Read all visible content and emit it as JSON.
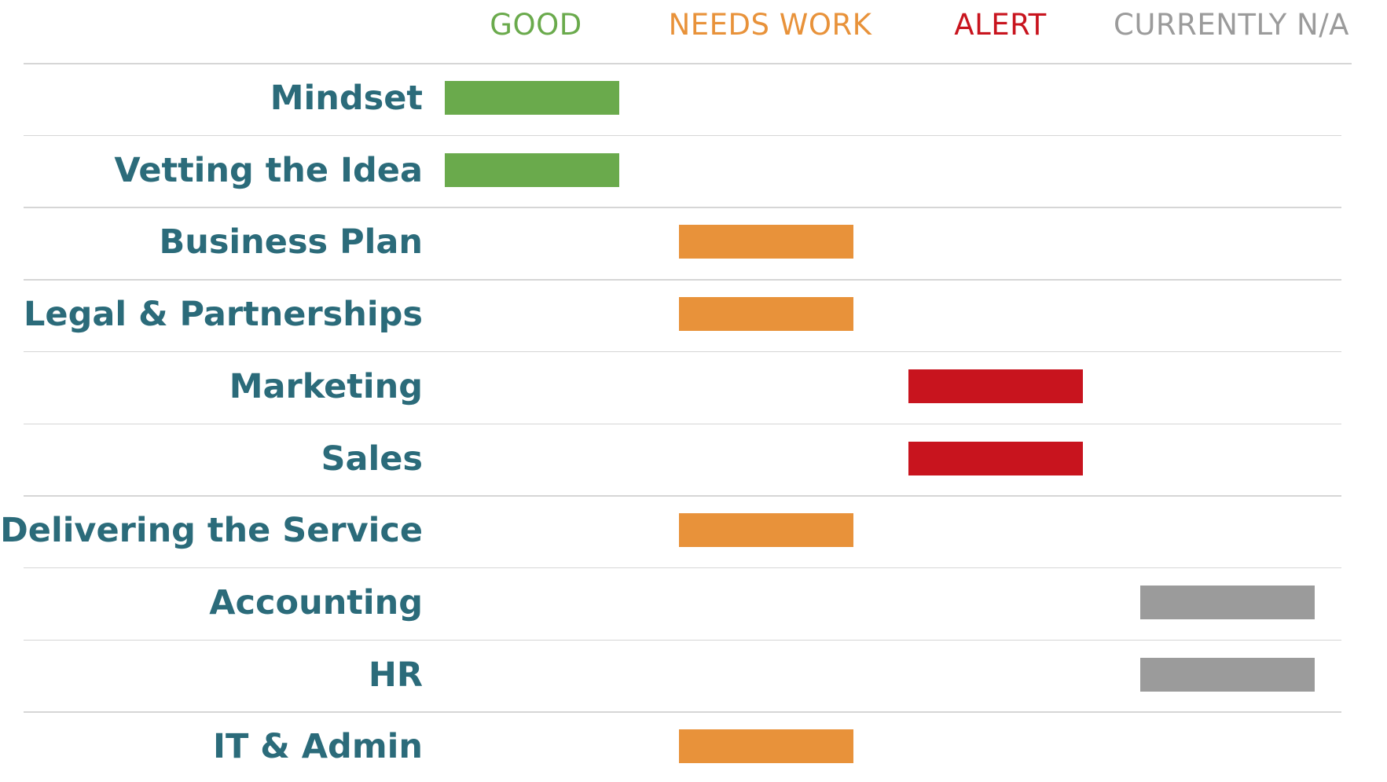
{
  "chart_data": {
    "type": "table",
    "columns": [
      {
        "key": "good",
        "label": "GOOD",
        "color": "#6aaa4c"
      },
      {
        "key": "needs_work",
        "label": "NEEDS WORK",
        "color": "#e8923a"
      },
      {
        "key": "alert",
        "label": "ALERT",
        "color": "#c8141e"
      },
      {
        "key": "na",
        "label": "CURRENTLY N/A",
        "color": "#9b9b9b"
      }
    ],
    "rows": [
      {
        "label": "Mindset",
        "status": "good"
      },
      {
        "label": "Vetting the Idea",
        "status": "good"
      },
      {
        "label": "Business Plan",
        "status": "needs_work"
      },
      {
        "label": "Legal & Partnerships",
        "status": "needs_work"
      },
      {
        "label": "Marketing",
        "status": "alert"
      },
      {
        "label": "Sales",
        "status": "alert"
      },
      {
        "label": "Delivering the Service",
        "status": "needs_work"
      },
      {
        "label": "Accounting",
        "status": "na"
      },
      {
        "label": "HR",
        "status": "na"
      },
      {
        "label": "IT & Admin",
        "status": "needs_work"
      }
    ],
    "label_color": "#2b6b7a",
    "grid": true
  }
}
